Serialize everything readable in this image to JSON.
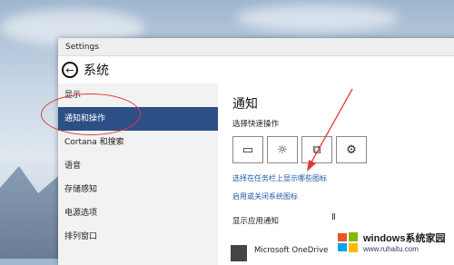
{
  "window": {
    "title": "Settings"
  },
  "header": {
    "title": "系统"
  },
  "sidebar": {
    "items": [
      {
        "label": "显示"
      },
      {
        "label": "通知和操作",
        "active": true
      },
      {
        "label": "Cortana 和搜索"
      },
      {
        "label": "语音"
      },
      {
        "label": "存储感知"
      },
      {
        "label": "电源选项"
      },
      {
        "label": "排列窗口"
      }
    ]
  },
  "content": {
    "section_title": "通知",
    "quick_actions_label": "选择快速操作",
    "tiles": [
      {
        "icon": "tablet-mode-icon",
        "glyph": "▭"
      },
      {
        "icon": "brightness-icon",
        "glyph": "☼"
      },
      {
        "icon": "project-icon",
        "glyph": "⧉"
      },
      {
        "icon": "settings-icon",
        "glyph": "⚙"
      }
    ],
    "link_taskbar_icons": "选择在任务栏上显示哪些图标",
    "link_system_icons": "启用或关闭系统图标",
    "show_app_notifications_label": "显示应用通知",
    "onedrive_label": "Microsoft OneDrive"
  },
  "watermark": {
    "line1": "windows系统家园",
    "line2": "www.ruhaitu.com"
  },
  "colors": {
    "accent": "#2c4f86",
    "annotation": "#e23a3a",
    "link": "#1f5aa6"
  }
}
